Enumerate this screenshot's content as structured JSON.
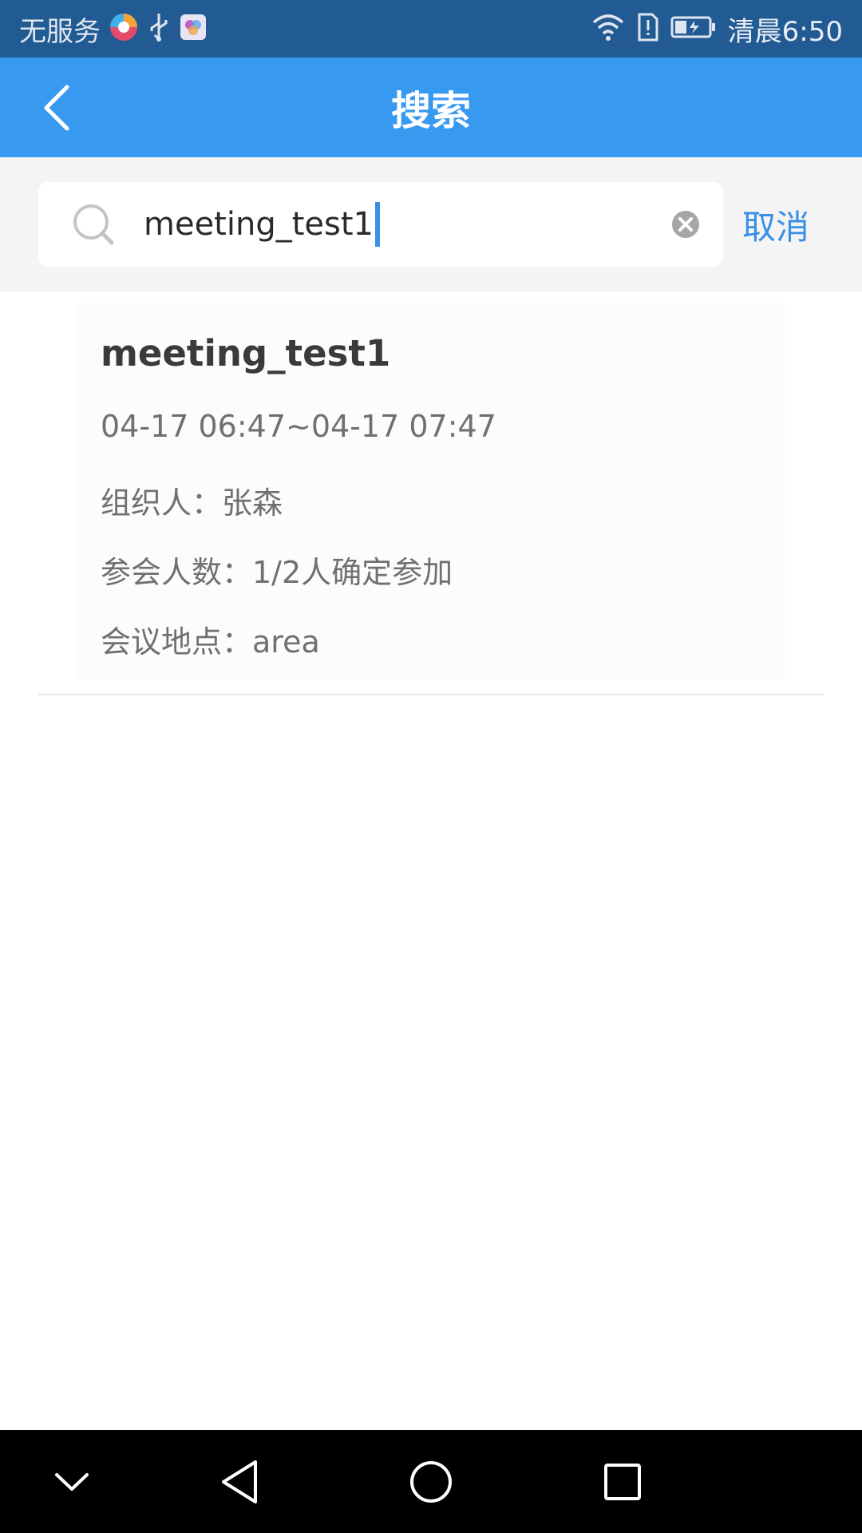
{
  "status_bar": {
    "carrier": "无服务",
    "time": "清晨6:50",
    "icons": [
      "browser-app-icon",
      "usb-icon",
      "gallery-app-icon",
      "wifi-icon",
      "sim-alert-icon",
      "battery-icon"
    ]
  },
  "header": {
    "title": "搜索",
    "back_icon": "chevron-left-icon"
  },
  "search": {
    "value": "meeting_test1",
    "icon": "search-icon",
    "clear_icon": "clear-icon",
    "cancel_label": "取消"
  },
  "results": [
    {
      "title": "meeting_test1",
      "time_range": "04-17 06:47~04-17 07:47",
      "organizer": "组织人：张森",
      "attendees": "参会人数：1/2人确定参加",
      "location": "会议地点：area"
    }
  ],
  "nav_bar": {
    "icons": [
      "chevron-down-icon",
      "back-triangle-icon",
      "home-circle-icon",
      "recents-square-icon"
    ]
  },
  "colors": {
    "status_bar": "#225a94",
    "header": "#3899f0",
    "accent": "#3a8fe6"
  }
}
